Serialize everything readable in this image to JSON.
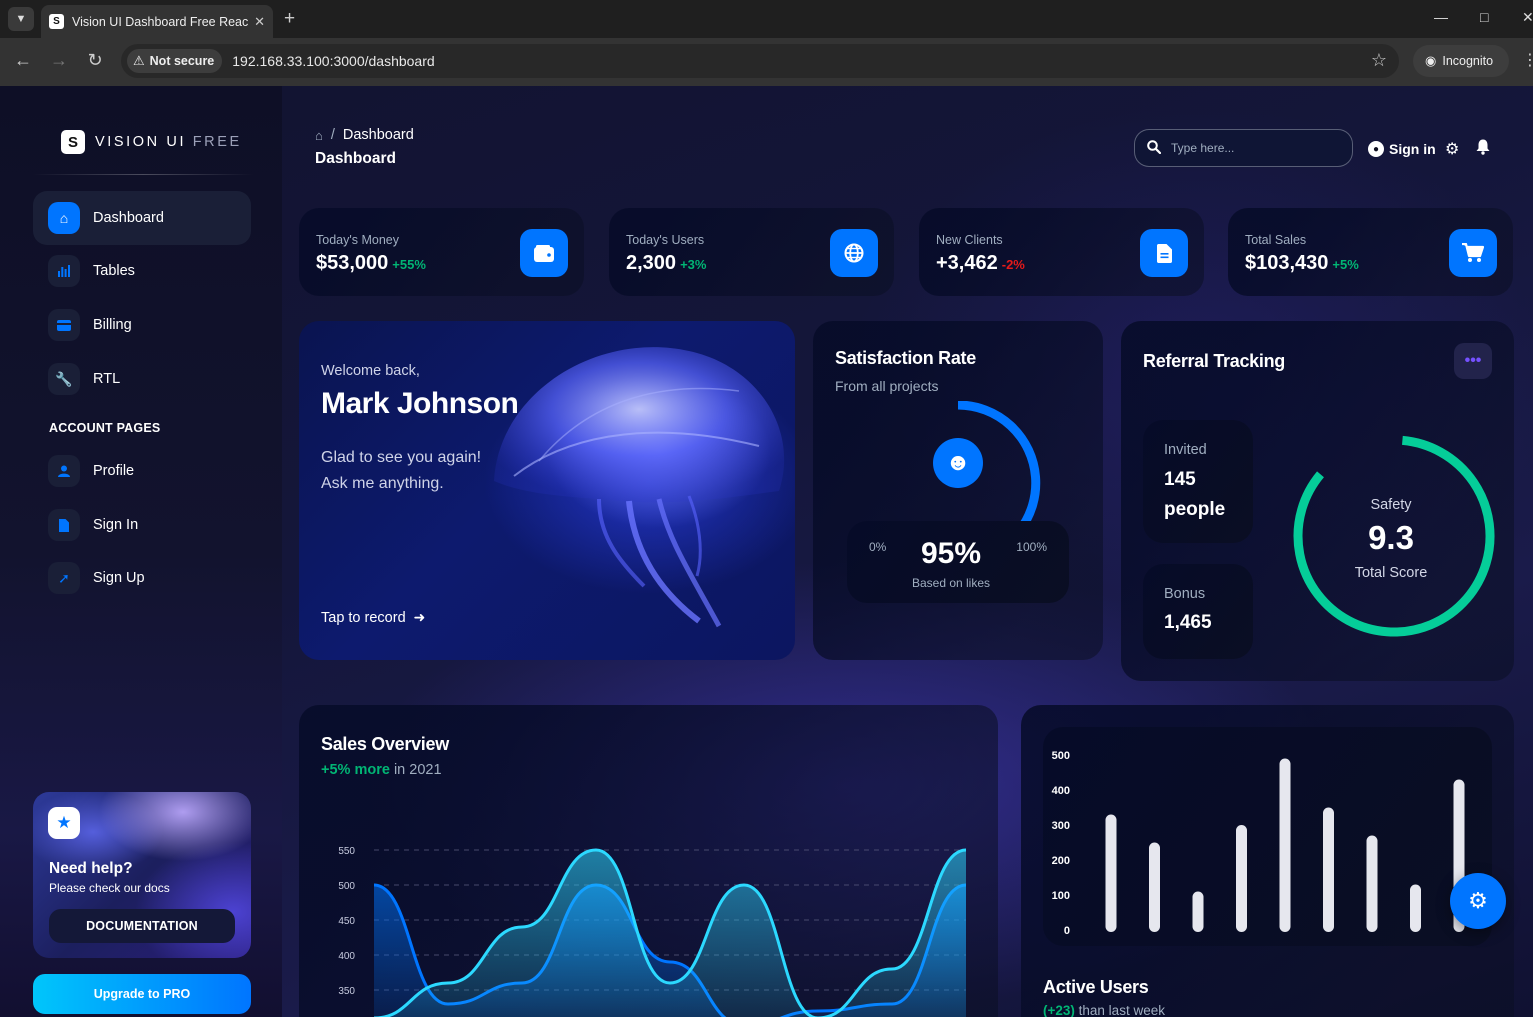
{
  "browser": {
    "tab_title": "Vision UI Dashboard Free React",
    "security_label": "Not secure",
    "url": "192.168.33.100:3000/dashboard",
    "incognito_label": "Incognito"
  },
  "sidebar": {
    "brand_main": "VISION UI ",
    "brand_free": "FREE",
    "items": [
      {
        "label": "Dashboard",
        "icon": "home-icon",
        "active": true
      },
      {
        "label": "Tables",
        "icon": "bar-chart-icon"
      },
      {
        "label": "Billing",
        "icon": "credit-card-icon"
      },
      {
        "label": "RTL",
        "icon": "wrench-icon"
      }
    ],
    "section_title": "ACCOUNT PAGES",
    "account_items": [
      {
        "label": "Profile",
        "icon": "person-icon"
      },
      {
        "label": "Sign In",
        "icon": "document-icon"
      },
      {
        "label": "Sign Up",
        "icon": "rocket-icon"
      }
    ],
    "help": {
      "title": "Need help?",
      "subtitle": "Please check our docs",
      "button": "DOCUMENTATION"
    },
    "upgrade_button": "Upgrade to PRO"
  },
  "header": {
    "breadcrumb": "Dashboard",
    "title": "Dashboard",
    "search_placeholder": "Type here...",
    "sign_in": "Sign in"
  },
  "stats": [
    {
      "label": "Today's Money",
      "value": "$53,000",
      "change": "+55%",
      "trend": "pos",
      "icon": "wallet-icon"
    },
    {
      "label": "Today's Users",
      "value": "2,300",
      "change": "+3%",
      "trend": "pos",
      "icon": "globe-icon"
    },
    {
      "label": "New Clients",
      "value": "+3,462",
      "change": "-2%",
      "trend": "neg",
      "icon": "document-icon"
    },
    {
      "label": "Total Sales",
      "value": "$103,430",
      "change": "+5%",
      "trend": "pos",
      "icon": "cart-icon"
    }
  ],
  "welcome": {
    "greeting": "Welcome back,",
    "name": "Mark Johnson",
    "line1": "Glad to see you again!",
    "line2": "Ask me anything.",
    "link": "Tap to record"
  },
  "satisfaction": {
    "title": "Satisfaction Rate",
    "subtitle": "From all projects",
    "min": "0%",
    "max": "100%",
    "value": "95%",
    "note": "Based on likes",
    "level": 0.95
  },
  "referral": {
    "title": "Referral Tracking",
    "invited_label": "Invited",
    "invited_value_1": "145",
    "invited_value_2": "people",
    "bonus_label": "Bonus",
    "bonus_value": "1,465",
    "safety_label": "Safety",
    "safety_value": "9.3",
    "safety_sub": "Total Score",
    "score_fraction": 0.93
  },
  "sales": {
    "title": "Sales Overview",
    "change": "+5% more",
    "period": " in 2021"
  },
  "active_users": {
    "title": "Active Users",
    "change": "(+23)",
    "subtitle": " than last week"
  },
  "colors": {
    "accent": "#0075ff",
    "positive": "#01b574",
    "negative": "#e31a1a",
    "safety": "#05cd99",
    "line_light": "#2cd9ff",
    "line_dark": "#0075ff"
  },
  "chart_data": [
    {
      "type": "area",
      "title": "Sales Overview",
      "ylim": [
        350,
        550
      ],
      "y_ticks": [
        "550",
        "500",
        "450",
        "400",
        "350"
      ],
      "series": [
        {
          "values": [
            500,
            330,
            360,
            500,
            390,
            300,
            320,
            330,
            500
          ]
        },
        {
          "values": [
            310,
            360,
            440,
            550,
            360,
            500,
            310,
            380,
            550
          ]
        }
      ]
    },
    {
      "type": "bar",
      "title": "Active Users",
      "ylim": [
        0,
        500
      ],
      "y_ticks": [
        "500",
        "400",
        "300",
        "200",
        "100",
        "0"
      ],
      "values": [
        330,
        250,
        110,
        300,
        490,
        350,
        270,
        130,
        430
      ]
    }
  ]
}
